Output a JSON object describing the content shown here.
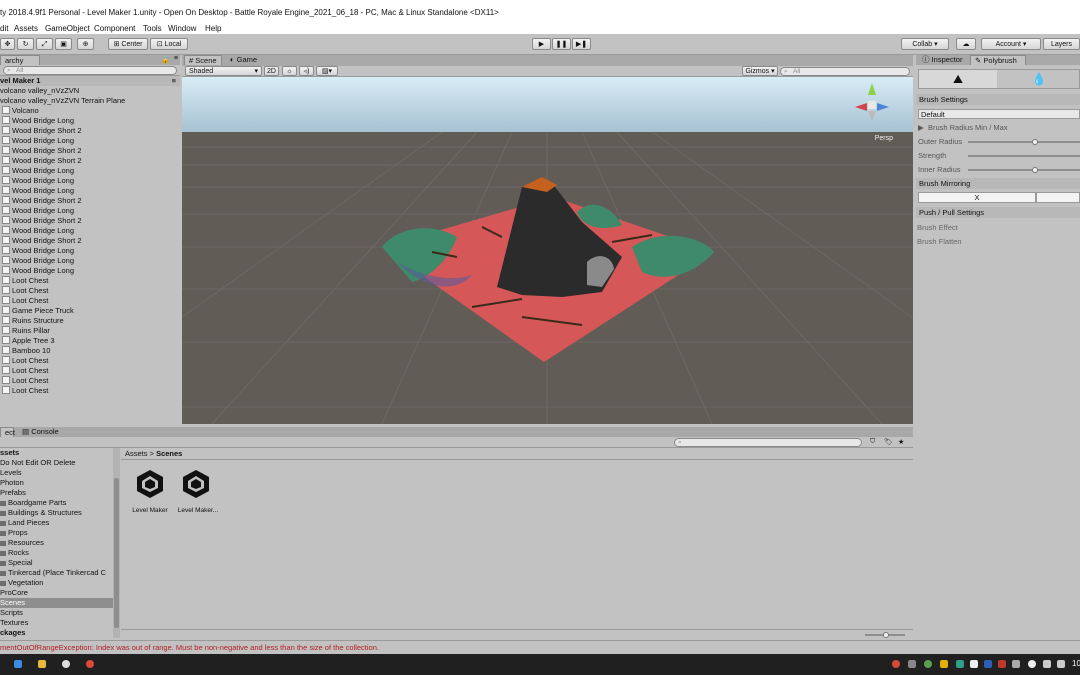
{
  "window": {
    "title": "ty 2018.4.9f1 Personal - Level Maker 1.unity - Open On Desktop - Battle Royale Engine_2021_06_18 - PC, Mac & Linux Standalone <DX11>"
  },
  "menu": [
    "dit",
    "Assets",
    "GameObject",
    "Component",
    "Tools",
    "Window",
    "Help"
  ],
  "toolbar": {
    "pivot": "Center",
    "space": "Local",
    "collab": "Collab",
    "account": "Account",
    "layers": "Layers"
  },
  "hierarchy": {
    "tab": "archy",
    "search_placeholder": "All",
    "scene_name": "vel Maker 1",
    "items": [
      {
        "label": "volcano valley_nVzZVN",
        "indent": 0,
        "icon": false
      },
      {
        "label": "volcano valley_nVzZVN Terrain Plane",
        "indent": 1,
        "icon": false
      },
      {
        "label": "Volcano",
        "indent": 1,
        "icon": true
      },
      {
        "label": "Wood Bridge Long",
        "indent": 1,
        "icon": true
      },
      {
        "label": "Wood Bridge Short 2",
        "indent": 1,
        "icon": true
      },
      {
        "label": "Wood Bridge Long",
        "indent": 1,
        "icon": true
      },
      {
        "label": "Wood Bridge Short 2",
        "indent": 1,
        "icon": true
      },
      {
        "label": "Wood Bridge Short 2",
        "indent": 1,
        "icon": true
      },
      {
        "label": "Wood Bridge Long",
        "indent": 1,
        "icon": true
      },
      {
        "label": "Wood Bridge Long",
        "indent": 1,
        "icon": true
      },
      {
        "label": "Wood Bridge Long",
        "indent": 1,
        "icon": true
      },
      {
        "label": "Wood Bridge Short 2",
        "indent": 1,
        "icon": true
      },
      {
        "label": "Wood Bridge Long",
        "indent": 1,
        "icon": true
      },
      {
        "label": "Wood Bridge Short 2",
        "indent": 1,
        "icon": true
      },
      {
        "label": "Wood Bridge Long",
        "indent": 1,
        "icon": true
      },
      {
        "label": "Wood Bridge Short 2",
        "indent": 1,
        "icon": true
      },
      {
        "label": "Wood Bridge Long",
        "indent": 1,
        "icon": true
      },
      {
        "label": "Wood Bridge Long",
        "indent": 1,
        "icon": true
      },
      {
        "label": "Wood Bridge Long",
        "indent": 1,
        "icon": true
      },
      {
        "label": "Loot Chest",
        "indent": 1,
        "icon": true
      },
      {
        "label": "Loot Chest",
        "indent": 1,
        "icon": true
      },
      {
        "label": "Loot Chest",
        "indent": 1,
        "icon": true
      },
      {
        "label": "Game Piece Truck",
        "indent": 1,
        "icon": true
      },
      {
        "label": "Ruins Structure",
        "indent": 1,
        "icon": true
      },
      {
        "label": "Ruins Pillar",
        "indent": 1,
        "icon": true
      },
      {
        "label": "Apple Tree 3",
        "indent": 1,
        "icon": true
      },
      {
        "label": "Bamboo 10",
        "indent": 1,
        "icon": true
      },
      {
        "label": "Loot Chest",
        "indent": 1,
        "icon": true
      },
      {
        "label": "Loot Chest",
        "indent": 1,
        "icon": true
      },
      {
        "label": "Loot Chest",
        "indent": 1,
        "icon": true
      },
      {
        "label": "Loot Chest",
        "indent": 1,
        "icon": true
      }
    ]
  },
  "scene": {
    "tabs": [
      "Scene",
      "Game"
    ],
    "shading": "Shaded",
    "mode_2d": "2D",
    "gizmos": "Gizmos",
    "search_placeholder": "All",
    "persp_label": "Persp"
  },
  "inspector": {
    "tabs": [
      "Inspector",
      "Polybrush"
    ],
    "brush_settings": "Brush Settings",
    "preset": "Default",
    "radius_header": "Brush Radius Min / Max",
    "outer_radius": "Outer Radius",
    "strength": "Strength",
    "inner_radius": "Inner Radius",
    "outer_radius_level": 0.6,
    "inner_radius_level": 0.6,
    "brush_mirroring": "Brush Mirroring",
    "mirror_axis": "X",
    "push_pull": "Push / Pull Settings",
    "brush_effect": "Brush Effect",
    "brush_flatten": "Brush Flatten"
  },
  "project": {
    "tabs": [
      "ect",
      "Console"
    ],
    "tree": [
      {
        "label": "ssets",
        "bold": true,
        "indent": 0,
        "folder": false
      },
      {
        "label": "Do Not Edit OR Delete",
        "bold": false,
        "indent": 0,
        "folder": false
      },
      {
        "label": "Levels",
        "bold": false,
        "indent": 0,
        "folder": false
      },
      {
        "label": "Photon",
        "bold": false,
        "indent": 0,
        "folder": false
      },
      {
        "label": "Prefabs",
        "bold": false,
        "indent": 0,
        "folder": false
      },
      {
        "label": "Boardgame Parts",
        "bold": false,
        "indent": 1,
        "folder": true
      },
      {
        "label": "Buildings & Structures",
        "bold": false,
        "indent": 1,
        "folder": true
      },
      {
        "label": "Land Pieces",
        "bold": false,
        "indent": 1,
        "folder": true
      },
      {
        "label": "Props",
        "bold": false,
        "indent": 1,
        "folder": true
      },
      {
        "label": "Resources",
        "bold": false,
        "indent": 1,
        "folder": true
      },
      {
        "label": "Rocks",
        "bold": false,
        "indent": 1,
        "folder": true
      },
      {
        "label": "Special",
        "bold": false,
        "indent": 1,
        "folder": true
      },
      {
        "label": "Tinkercad (Place Tinkercad C",
        "bold": false,
        "indent": 1,
        "folder": true
      },
      {
        "label": "Vegetation",
        "bold": false,
        "indent": 1,
        "folder": true
      },
      {
        "label": "ProCore",
        "bold": false,
        "indent": 0,
        "folder": false
      },
      {
        "label": "Scenes",
        "bold": false,
        "indent": 0,
        "folder": false,
        "selected": true
      },
      {
        "label": "Scripts",
        "bold": false,
        "indent": 0,
        "folder": false
      },
      {
        "label": "Textures",
        "bold": false,
        "indent": 0,
        "folder": false
      },
      {
        "label": "ckages",
        "bold": true,
        "indent": 0,
        "folder": false
      }
    ],
    "breadcrumb": [
      "Assets",
      "Scenes"
    ],
    "assets": [
      "Level Maker",
      "Level Maker..."
    ]
  },
  "status": {
    "error": "mentOutOfRangeException: Index was out of range. Must be non-negative and less than the size of the collection."
  },
  "taskbar": {
    "clock": "10"
  },
  "colors": {
    "editor_bg": "#c2c2c2",
    "selection": "#8e8e8e",
    "error_text": "#b02020",
    "terrain_red": "#d65757",
    "terrain_green": "#3e8a6a",
    "taskbar": "#202020"
  }
}
